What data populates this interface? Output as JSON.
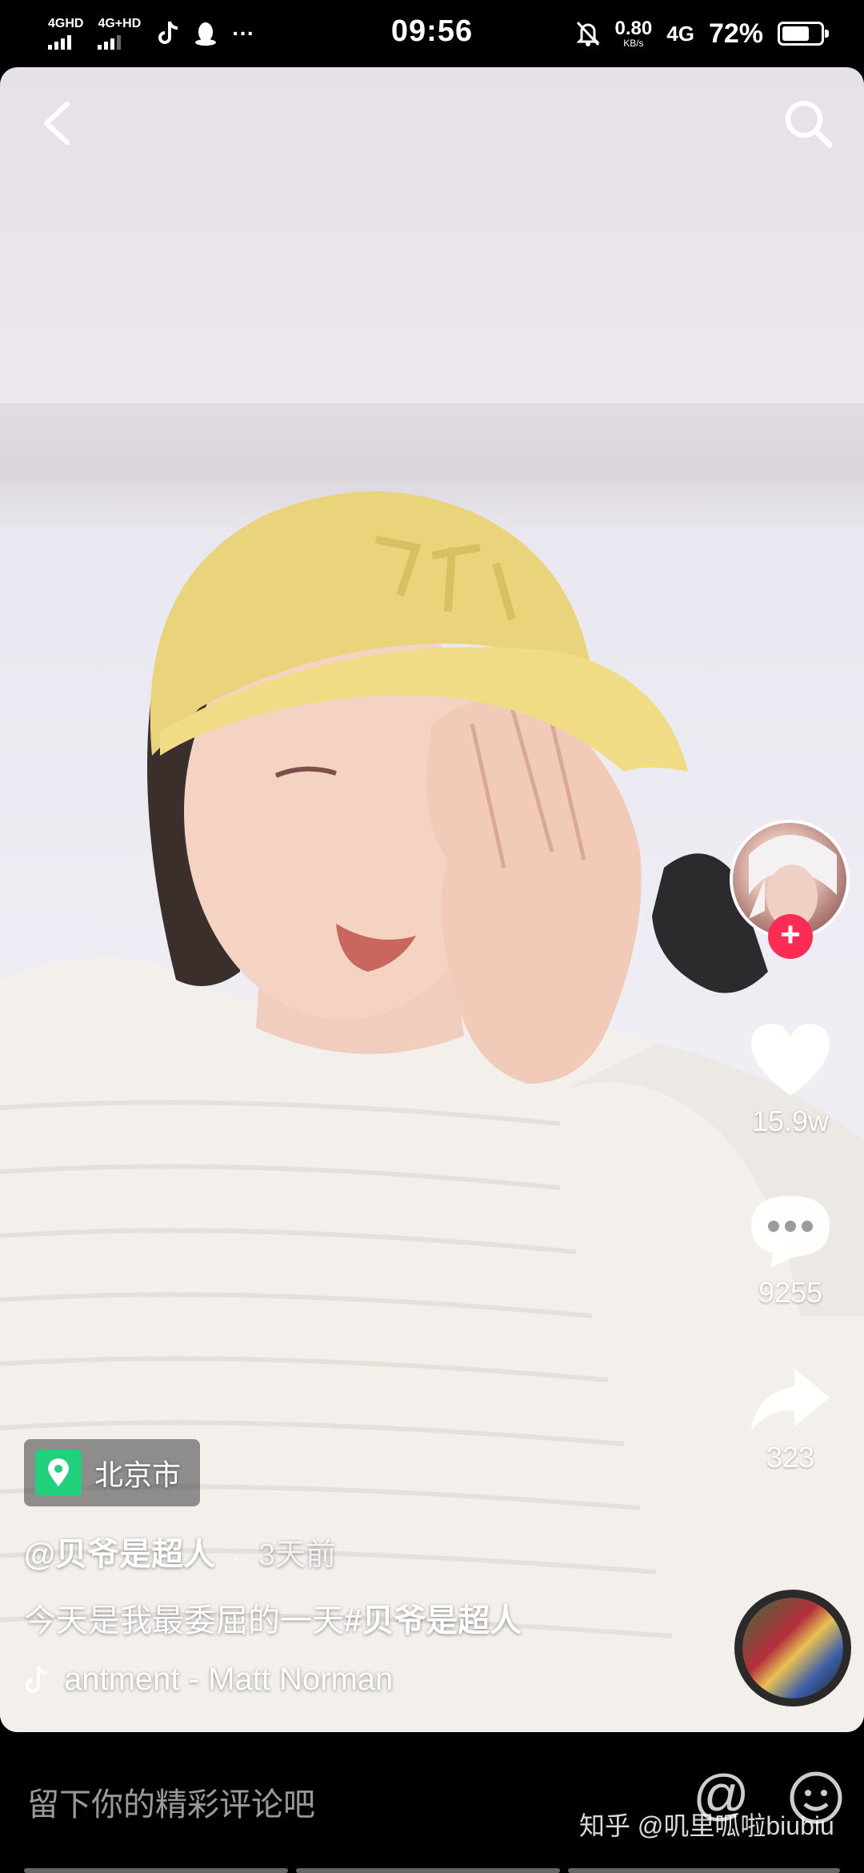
{
  "status_bar": {
    "signal1_label": "4GHD",
    "signal2_label": "4G+HD",
    "more_indicator": "···",
    "time": "09:56",
    "net_speed": "0.80",
    "net_speed_unit": "KB/s",
    "network": "4G",
    "battery": "72%",
    "battery_level": 0.72
  },
  "video": {
    "location": "北京市",
    "author": "@贝爷是超人",
    "dot": "·",
    "time_ago": "3天前",
    "caption_text": "今天是我最委屈的一天",
    "caption_hashtag": "#贝爷是超人",
    "music": "antment - Matt Norman"
  },
  "actions": {
    "likes": "15.9w",
    "comments": "9255",
    "shares": "323",
    "follow_symbol": "+"
  },
  "comment_bar": {
    "placeholder": "留下你的精彩评论吧",
    "at_symbol": "@",
    "watermark": "知乎 @叽里呱啦biubiu"
  },
  "colors": {
    "follow_accent": "#fe2c55",
    "location_pin": "#21d07a"
  }
}
